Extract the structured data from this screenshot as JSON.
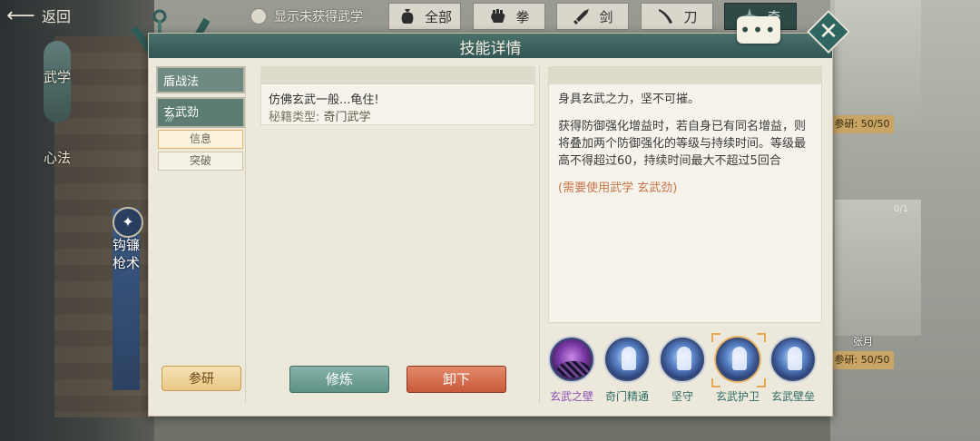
{
  "topbar": {
    "back_label": "返回",
    "show_unobtained_label": "显示未获得武学",
    "filter_tabs": [
      {
        "label": "全部",
        "icon": "sack-icon"
      },
      {
        "label": "拳",
        "icon": "fist-icon"
      },
      {
        "label": "剑",
        "icon": "sword-icon"
      },
      {
        "label": "刀",
        "icon": "saber-icon"
      },
      {
        "label": "奇",
        "icon": "shuriken-icon"
      }
    ]
  },
  "background": {
    "side_tabs": {
      "wuxue": "武学",
      "xinfa": "心法",
      "gou": "钩镰枪术"
    },
    "right_cards": [
      {
        "stat": "参研: 50/50"
      },
      {
        "stat": "参研: 50/50"
      }
    ],
    "card_name": "张月",
    "card_count": "0/1"
  },
  "modal": {
    "title": "技能详情",
    "chat_label": "•••",
    "skill_list": [
      {
        "label": "盾战法"
      },
      {
        "label": "玄武劲"
      }
    ],
    "selected_pips": "⁄⁄⁄",
    "sub_buttons": [
      "信息",
      "突破"
    ],
    "research_label": "参研",
    "mid": {
      "line1": "仿佛玄武一般...龟住!",
      "type_label": "秘籍类型:",
      "type_value": "奇门武学"
    },
    "train_label": "修炼",
    "unload_label": "卸下",
    "description": {
      "p1": "身具玄武之力，坚不可摧。",
      "p2": "获得防御强化增益时，若自身已有同名增益，则将叠加两个防御强化的等级与持续时间。等级最高不得超过60，持续时间最大不超过5回合",
      "requirement": "(需要使用武学 玄武劲)"
    },
    "skills": [
      {
        "label": "玄武之壁",
        "style": "purple",
        "selected": false
      },
      {
        "label": "奇门精通",
        "style": "blue",
        "selected": false
      },
      {
        "label": "坚守",
        "style": "blue",
        "selected": false
      },
      {
        "label": "玄武护卫",
        "style": "blue",
        "selected": true
      },
      {
        "label": "玄武壁垒",
        "style": "blue",
        "selected": false
      }
    ]
  }
}
